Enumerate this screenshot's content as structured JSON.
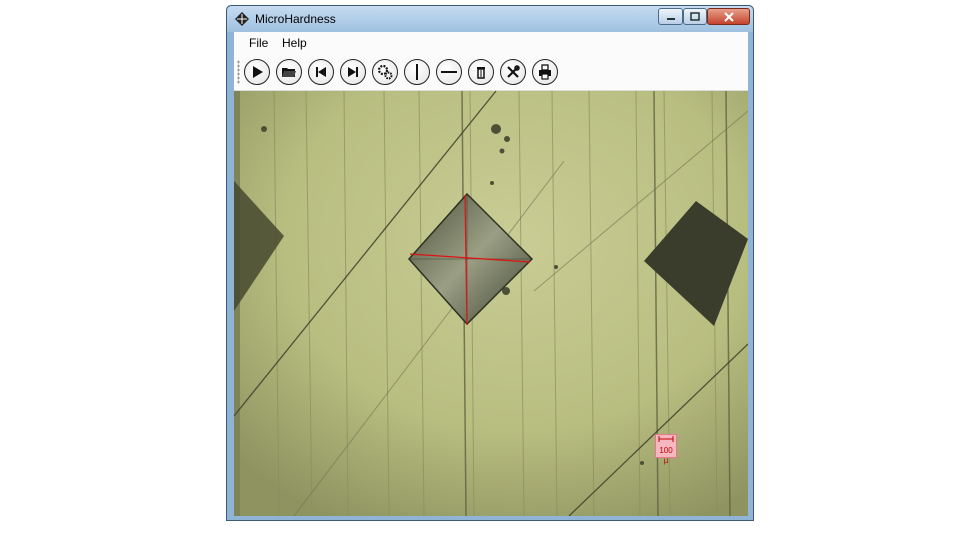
{
  "window": {
    "title": "MicroHardness",
    "icon": "diamond-app-icon",
    "controls": [
      "minimize-icon",
      "maximize-icon",
      "close-icon"
    ]
  },
  "menu": [
    {
      "label": "File"
    },
    {
      "label": "Help"
    }
  ],
  "toolbar": [
    {
      "name": "play-button",
      "icon": "play-icon"
    },
    {
      "name": "open-button",
      "icon": "folder-open-icon"
    },
    {
      "name": "previous-button",
      "icon": "skip-back-icon"
    },
    {
      "name": "next-button",
      "icon": "skip-forward-icon"
    },
    {
      "name": "settings-button",
      "icon": "gears-icon"
    },
    {
      "name": "vertical-line-button",
      "icon": "vertical-line-icon"
    },
    {
      "name": "horizontal-line-button",
      "icon": "horizontal-line-icon"
    },
    {
      "name": "delete-button",
      "icon": "trash-icon"
    },
    {
      "name": "tools-button",
      "icon": "tools-icon"
    },
    {
      "name": "print-button",
      "icon": "printer-icon"
    }
  ],
  "viewer": {
    "scale_label": "100 µ",
    "crosshair_color": "#e01010",
    "background_color": "#b8bd80"
  }
}
